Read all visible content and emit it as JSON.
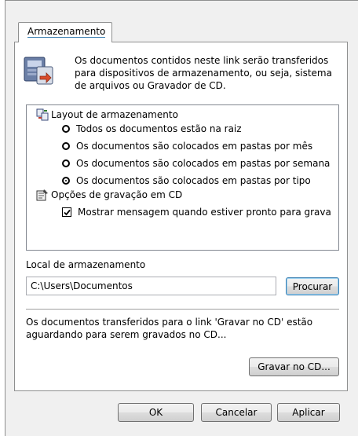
{
  "tab": {
    "label": "Armazenamento"
  },
  "description": "Os documentos contidos neste link serão transferidos para dispositivos de armazenamento, ou seja, sistema de arquivos ou Gravador de CD.",
  "storage_layout": {
    "group_label": "Layout de armazenamento",
    "options": [
      {
        "label": "Todos os documentos estão na raiz",
        "selected": false
      },
      {
        "label": "Os documentos são colocados em pastas por mês",
        "selected": false
      },
      {
        "label": "Os documentos são colocados em pastas por semana",
        "selected": false
      },
      {
        "label": "Os documentos são colocados em pastas por tipo",
        "selected": true
      }
    ]
  },
  "cd_options": {
    "group_label": "Opções de gravação em CD",
    "checkbox_label": "Mostrar mensagem quando estiver pronto para grava",
    "checked": true
  },
  "location": {
    "label": "Local de armazenamento",
    "value": "C:\\Users\\Documentos",
    "browse_button": "Procurar"
  },
  "burn_note": "Os documentos transferidos para o link 'Gravar no CD' estão aguardando para serem gravados no CD...",
  "burn_button": "Gravar no CD...",
  "footer": {
    "ok": "OK",
    "cancel": "Cancelar",
    "apply": "Aplicar"
  }
}
